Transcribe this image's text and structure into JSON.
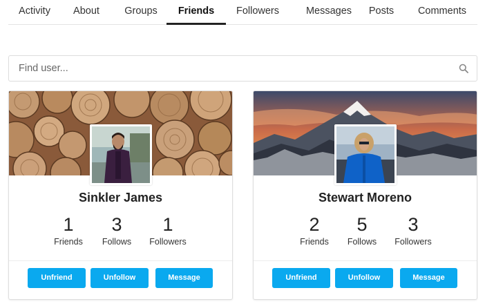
{
  "tabs": [
    {
      "label": "Activity"
    },
    {
      "label": "About"
    },
    {
      "label": "Groups"
    },
    {
      "label": "Friends",
      "active": true
    },
    {
      "label": "Followers"
    },
    {
      "label": "Messages"
    },
    {
      "label": "Posts"
    },
    {
      "label": "Comments"
    }
  ],
  "search": {
    "placeholder": "Find user...",
    "value": "",
    "icon": "search-icon"
  },
  "accent_color": "#0aa9ef",
  "users": [
    {
      "name": "Sinkler James",
      "cover": "wood-logs-cover",
      "stats": [
        {
          "value": "1",
          "label": "Friends"
        },
        {
          "value": "3",
          "label": "Follows"
        },
        {
          "value": "1",
          "label": "Followers"
        }
      ],
      "buttons": {
        "unfriend": "Unfriend",
        "unfollow": "Unfollow",
        "message": "Message"
      }
    },
    {
      "name": "Stewart Moreno",
      "cover": "mountain-sunset-cover",
      "stats": [
        {
          "value": "2",
          "label": "Friends"
        },
        {
          "value": "5",
          "label": "Follows"
        },
        {
          "value": "3",
          "label": "Followers"
        }
      ],
      "buttons": {
        "unfriend": "Unfriend",
        "unfollow": "Unfollow",
        "message": "Message"
      }
    }
  ]
}
